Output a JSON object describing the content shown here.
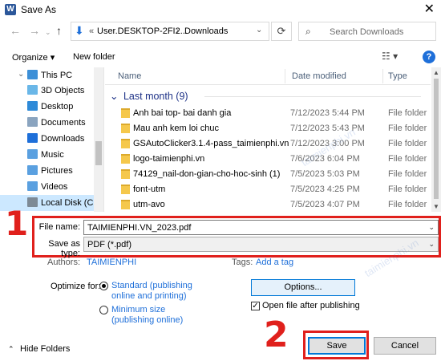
{
  "window": {
    "title": "Save As",
    "app_icon": "word-icon",
    "close_glyph": "✕"
  },
  "address": {
    "back": "←",
    "forward": "→",
    "up": "↑",
    "path_prefix": "«",
    "path_root": "User.DESKTOP-2FI2...",
    "separator": "›",
    "path_current": "Downloads",
    "refresh": "⟳",
    "search_placeholder": "Search Downloads"
  },
  "toolbar": {
    "organize_label": "Organize ▾",
    "new_folder_label": "New folder",
    "view_glyph": "☷ ▾",
    "help_glyph": "?"
  },
  "nav": {
    "items": [
      {
        "label": "This PC",
        "icon": "pc-icon",
        "color": "#3c8fd7",
        "chevron": "⌄"
      },
      {
        "label": "3D Objects",
        "icon": "3d-objects-icon",
        "color": "#6ab7e8",
        "chevron": ""
      },
      {
        "label": "Desktop",
        "icon": "desktop-icon",
        "color": "#2e8ad8",
        "chevron": ""
      },
      {
        "label": "Documents",
        "icon": "documents-icon",
        "color": "#8aa4bf",
        "chevron": ""
      },
      {
        "label": "Downloads",
        "icon": "downloads-icon",
        "color": "#1e6fd9",
        "chevron": ""
      },
      {
        "label": "Music",
        "icon": "music-icon",
        "color": "#5aa0e0",
        "chevron": ""
      },
      {
        "label": "Pictures",
        "icon": "pictures-icon",
        "color": "#5aa0e0",
        "chevron": ""
      },
      {
        "label": "Videos",
        "icon": "videos-icon",
        "color": "#5aa0e0",
        "chevron": ""
      },
      {
        "label": "Local Disk (C:)",
        "icon": "disk-icon",
        "color": "#7d8a96",
        "chevron": ""
      }
    ]
  },
  "list": {
    "columns": [
      "Name",
      "Date modified",
      "Type"
    ],
    "group_label": "Last month (9)",
    "group_chevron": "⌄",
    "rows": [
      {
        "name": "Anh bai top- bai danh gia",
        "date": "7/12/2023 5:44 PM",
        "type": "File folder"
      },
      {
        "name": "Mau anh kem loi chuc",
        "date": "7/12/2023 5:43 PM",
        "type": "File folder"
      },
      {
        "name": "GSAutoClicker3.1.4-pass_taimienphi.vn",
        "date": "7/12/2023 3:00 PM",
        "type": "File folder"
      },
      {
        "name": "logo-taimienphi.vn",
        "date": "7/6/2023 6:04 PM",
        "type": "File folder"
      },
      {
        "name": "74129_nail-don-gian-cho-hoc-sinh (1)",
        "date": "7/5/2023 5:03 PM",
        "type": "File folder"
      },
      {
        "name": "font-utm",
        "date": "7/5/2023 4:25 PM",
        "type": "File folder"
      },
      {
        "name": "utm-avo",
        "date": "7/5/2023 4:07 PM",
        "type": "File folder"
      }
    ]
  },
  "form": {
    "file_name_label": "File name:",
    "file_name_value": "TAIMIENPHI.VN_2023.pdf",
    "save_type_label": "Save as type:",
    "save_type_value": "PDF (*.pdf)",
    "authors_label": "Authors:",
    "authors_value": "TAIMIENPHI",
    "tags_label": "Tags:",
    "tags_value": "Add a tag",
    "optimize_label": "Optimize for:",
    "opt_standard_line1": "Standard (publishing",
    "opt_standard_line2": "online and printing)",
    "opt_minimum_line1": "Minimum size",
    "opt_minimum_line2": "(publishing online)",
    "options_button": "Options...",
    "open_after_label": "Open file after publishing",
    "open_after_checked": true,
    "hide_folders": "Hide Folders",
    "hide_chevron": "⌃",
    "save_button": "Save",
    "cancel_button": "Cancel"
  },
  "annotations": {
    "step1": "1",
    "step2": "2",
    "highlight_color": "#e0201c"
  },
  "watermark": "taimienphi.vn"
}
